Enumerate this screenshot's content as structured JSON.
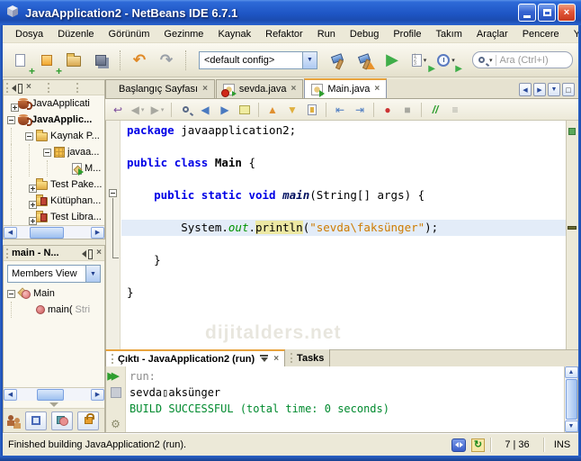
{
  "window": {
    "title": "JavaApplication2 - NetBeans IDE 6.7.1"
  },
  "menu": {
    "items": [
      "Dosya",
      "Düzenle",
      "Görünüm",
      "Gezinme",
      "Kaynak",
      "Refaktor",
      "Run",
      "Debug",
      "Profile",
      "Takım",
      "Araçlar",
      "Pencere",
      "Yardım"
    ]
  },
  "toolbar": {
    "config_combo": "<default config>",
    "search_placeholder": "Ara (Ctrl+I)"
  },
  "projects": {
    "items": [
      {
        "label": "JavaApplicati",
        "indent": 0,
        "expand": "plus",
        "icon": "project",
        "bold": false
      },
      {
        "label": "JavaApplic...",
        "indent": 0,
        "expand": "minus",
        "icon": "project",
        "bold": true
      },
      {
        "label": "Kaynak P...",
        "indent": 1,
        "expand": "minus",
        "icon": "folder",
        "bold": false
      },
      {
        "label": "javaa...",
        "indent": 2,
        "expand": "minus",
        "icon": "package",
        "bold": false
      },
      {
        "label": "M...",
        "indent": 3,
        "expand": "none",
        "icon": "javafile",
        "bold": false
      },
      {
        "label": "Test Pake...",
        "indent": 1,
        "expand": "plus",
        "icon": "folder",
        "bold": false
      },
      {
        "label": "Kütüphan...",
        "indent": 1,
        "expand": "plus",
        "icon": "libfolder",
        "bold": false
      },
      {
        "label": "Test Libra...",
        "indent": 1,
        "expand": "plus",
        "icon": "libfolder",
        "bold": false
      }
    ]
  },
  "navigator": {
    "title": "main - N...",
    "combo_value": "Members View",
    "items": [
      {
        "label": "Main",
        "suffix": "",
        "indent": 0,
        "expand": "minus",
        "icon": "class"
      },
      {
        "label": "main(",
        "suffix": "Stri",
        "indent": 1,
        "expand": "none",
        "icon": "method"
      }
    ]
  },
  "editor": {
    "tabs": [
      {
        "label": "Başlangıç Sayfası",
        "icon": "none",
        "active": false
      },
      {
        "label": "sevda.java",
        "icon": "err",
        "active": false
      },
      {
        "label": "Main.java",
        "icon": "run",
        "active": true
      }
    ],
    "watermark": "dijitalders.net",
    "lines": [
      {
        "tokens": [
          [
            "kw",
            "package"
          ],
          [
            "pl",
            " javaapplication2;"
          ]
        ]
      },
      {
        "tokens": []
      },
      {
        "tokens": [
          [
            "kw",
            "public"
          ],
          [
            "pl",
            " "
          ],
          [
            "kw",
            "class"
          ],
          [
            "pl",
            " "
          ],
          [
            "cls",
            "Main"
          ],
          [
            "pl",
            " {"
          ]
        ]
      },
      {
        "tokens": []
      },
      {
        "tokens": [
          [
            "pl",
            "    "
          ],
          [
            "kw",
            "public"
          ],
          [
            "pl",
            " "
          ],
          [
            "kw",
            "static"
          ],
          [
            "pl",
            " "
          ],
          [
            "kw",
            "void"
          ],
          [
            "pl",
            " "
          ],
          [
            "mth",
            "main"
          ],
          [
            "pl",
            "(String[] args) {"
          ]
        ]
      },
      {
        "tokens": []
      },
      {
        "current": true,
        "tokens": [
          [
            "pl",
            "        System."
          ],
          [
            "fld",
            "out"
          ],
          [
            "pl",
            "."
          ],
          [
            "occ",
            "println"
          ],
          [
            "pl",
            "("
          ],
          [
            "str",
            "\"sevda\\faksünger\""
          ],
          [
            "pl",
            ");"
          ]
        ]
      },
      {
        "tokens": []
      },
      {
        "tokens": [
          [
            "pl",
            "    }"
          ]
        ]
      },
      {
        "tokens": []
      },
      {
        "tokens": [
          [
            "pl",
            "}"
          ]
        ]
      }
    ]
  },
  "output": {
    "tabs": [
      {
        "label": "Çıktı - JavaApplication2 (run)",
        "active": true
      },
      {
        "label": "Tasks",
        "active": false
      }
    ],
    "lines": [
      {
        "cls": "dim",
        "text": "run:"
      },
      {
        "cls": "plain",
        "text": "sevda▯aksünger"
      },
      {
        "cls": "success",
        "text": "BUILD SUCCESSFUL (total time: 0 seconds)"
      }
    ]
  },
  "statusbar": {
    "message": "Finished building JavaApplication2 (run).",
    "caret_position": "7 | 36",
    "insert_mode": "INS"
  }
}
